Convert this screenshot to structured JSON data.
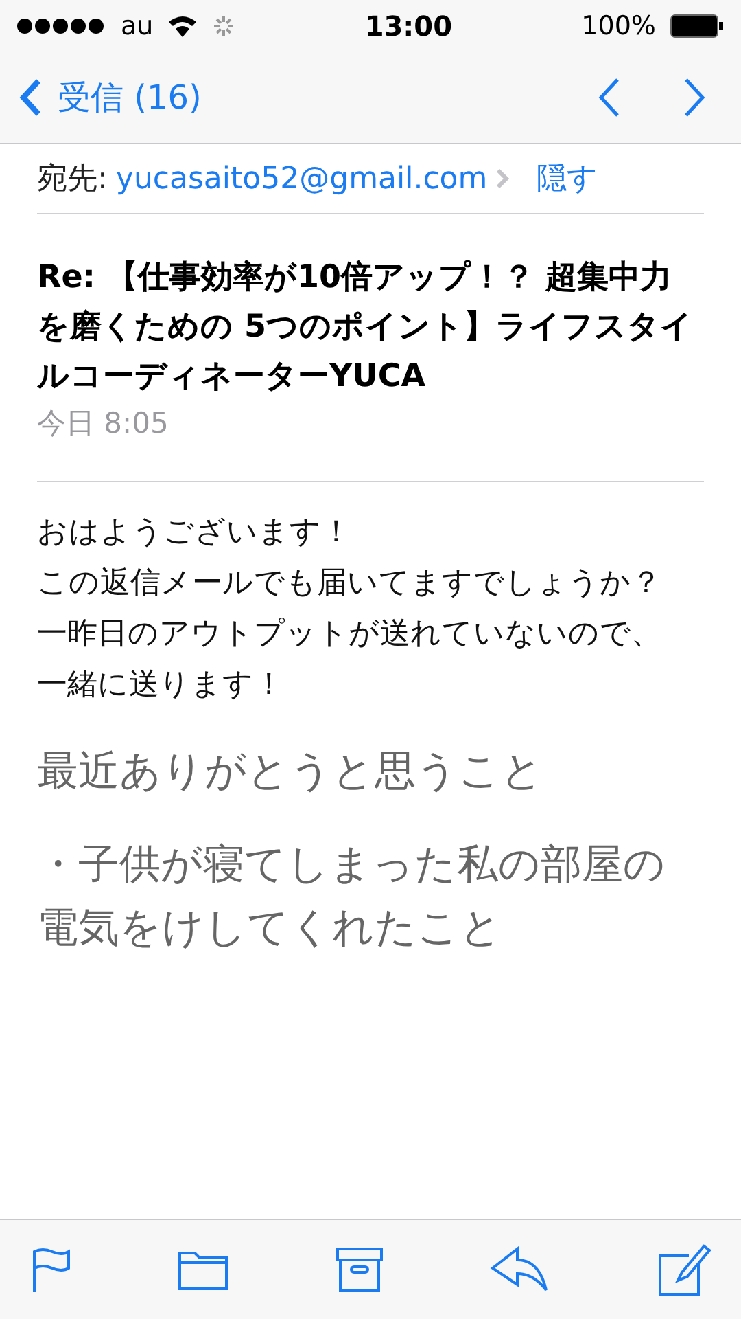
{
  "status_bar": {
    "carrier": "au",
    "time": "13:00",
    "battery": "100%"
  },
  "nav": {
    "back": "受信 (16)"
  },
  "header": {
    "to_label": "宛先:",
    "to_address": "yucasaito52@gmail.com",
    "hide": "隠す"
  },
  "subject": "Re: 【仕事効率が10倍アップ！？ 超集中力を磨くための 5つのポイント】ライフスタイルコーディネーターYUCA",
  "date": "今日 8:05",
  "body": [
    {
      "kind": "normal",
      "text": "おはようございます！"
    },
    {
      "kind": "normal",
      "text": "この返信メールでも届いてますでしょうか？"
    },
    {
      "kind": "normal",
      "text": "一昨日のアウトプットが送れていないので、"
    },
    {
      "kind": "normal",
      "text": "一緒に送ります！"
    },
    {
      "kind": "quote",
      "text": "最近ありがとうと思うこと"
    },
    {
      "kind": "quote",
      "text": "・子供が寝てしまった私の部屋の電気をけしてくれたこと"
    }
  ]
}
